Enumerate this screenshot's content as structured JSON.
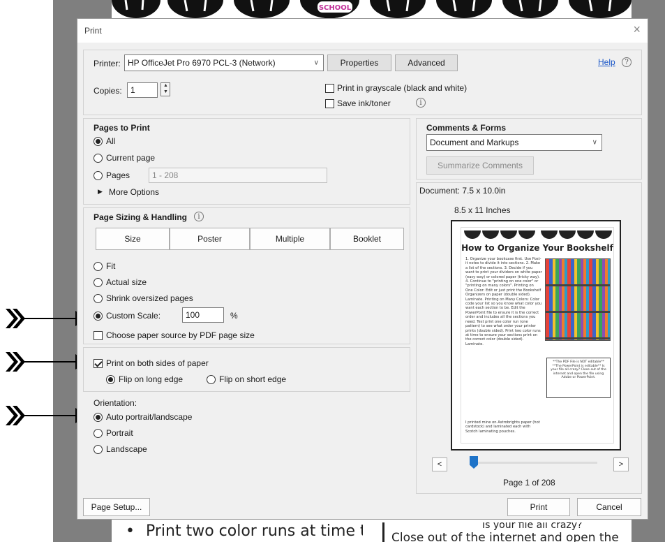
{
  "dialog": {
    "title": "Print",
    "close_glyph": "×"
  },
  "printer": {
    "label": "Printer:",
    "selected": "HP OfficeJet Pro 6970 PCL-3 (Network)",
    "properties_label": "Properties",
    "advanced_label": "Advanced",
    "help_label": "Help",
    "help_icon": "?"
  },
  "copies": {
    "label": "Copies:",
    "value": "1"
  },
  "options": {
    "grayscale_label": "Print in grayscale (black and white)",
    "grayscale_checked": false,
    "save_ink_label": "Save ink/toner",
    "save_ink_checked": false,
    "info_icon": "i"
  },
  "pages_to_print": {
    "heading": "Pages to Print",
    "all_label": "All",
    "current_label": "Current page",
    "pages_label": "Pages",
    "pages_value": "1 - 208",
    "more_options_label": "More Options",
    "selected": "all"
  },
  "sizing": {
    "heading": "Page Sizing & Handling",
    "info_icon": "i",
    "buttons": [
      "Size",
      "Poster",
      "Multiple",
      "Booklet"
    ],
    "fit_label": "Fit",
    "actual_label": "Actual size",
    "shrink_label": "Shrink oversized pages",
    "custom_label": "Custom Scale:",
    "custom_value": "100",
    "percent": "%",
    "selected": "custom",
    "paper_source_label": "Choose paper source by PDF page size",
    "paper_source_checked": false
  },
  "duplex": {
    "both_sides_label": "Print on both sides of paper",
    "both_sides_checked": true,
    "long_edge_label": "Flip on long edge",
    "short_edge_label": "Flip on short edge",
    "selected": "long"
  },
  "orientation": {
    "heading": "Orientation:",
    "auto_label": "Auto portrait/landscape",
    "portrait_label": "Portrait",
    "landscape_label": "Landscape",
    "selected": "auto"
  },
  "comments_forms": {
    "heading": "Comments & Forms",
    "selected": "Document and Markups",
    "summarize_label": "Summarize Comments"
  },
  "preview": {
    "document_size": "Document: 7.5 x 10.0in",
    "paper_size": "8.5 x 11 Inches",
    "page_indicator": "Page 1 of 208",
    "prev_glyph": "<",
    "next_glyph": ">",
    "page_position": 0.0,
    "thumb_title": "How to Organize Your Bookshelf",
    "thumb_steps": "1. Organize your bookcase first. Use Post-it notes to divide it into sections. 2. Make a list of the sections. 3. Decide if you want to print your dividers on white paper (easy way) or colored paper (tricky way). 4. Continue to \"printing on one color\" or \"printing on many colors\". Printing on One Color: Edit or just print the Bookshelf Organizers on paper (double sided). Laminate. Printing on Many Colors: Color code your list so you know what color you want each section to be. Edit the PowerPoint file to ensure it is the correct order and includes all the sections you need. Test print one color run (one pattern) to see what order your printer prints (double sided). Print two color runs at time to ensure your sections print on the correct color (double sided). Laminate.",
    "thumb_box": "**The PDF File is NOT editable** **The PowerPoint is editable** Is your file all crazy? Close out of the internet and open the file using Adobe or PowerPoint.",
    "thumb_footer": "I printed mine on Astrobrights paper (hot cardstock) and laminated each with Scotch laminating pouches."
  },
  "footer": {
    "page_setup_label": "Page Setup...",
    "print_label": "Print",
    "cancel_label": "Cancel"
  },
  "background": {
    "badge_text": "SCHOOL",
    "bottom_left_text": "Print two color runs at time to",
    "bottom_right_line1": "Is your file all crazy?",
    "bottom_right_line2": "Close out of the internet and open the"
  },
  "colors": {
    "dialog_bg": "#f0f0f0",
    "link": "#1a56c8",
    "slider_thumb": "#1e73c8",
    "outer_gray": "#7f7f7f"
  }
}
